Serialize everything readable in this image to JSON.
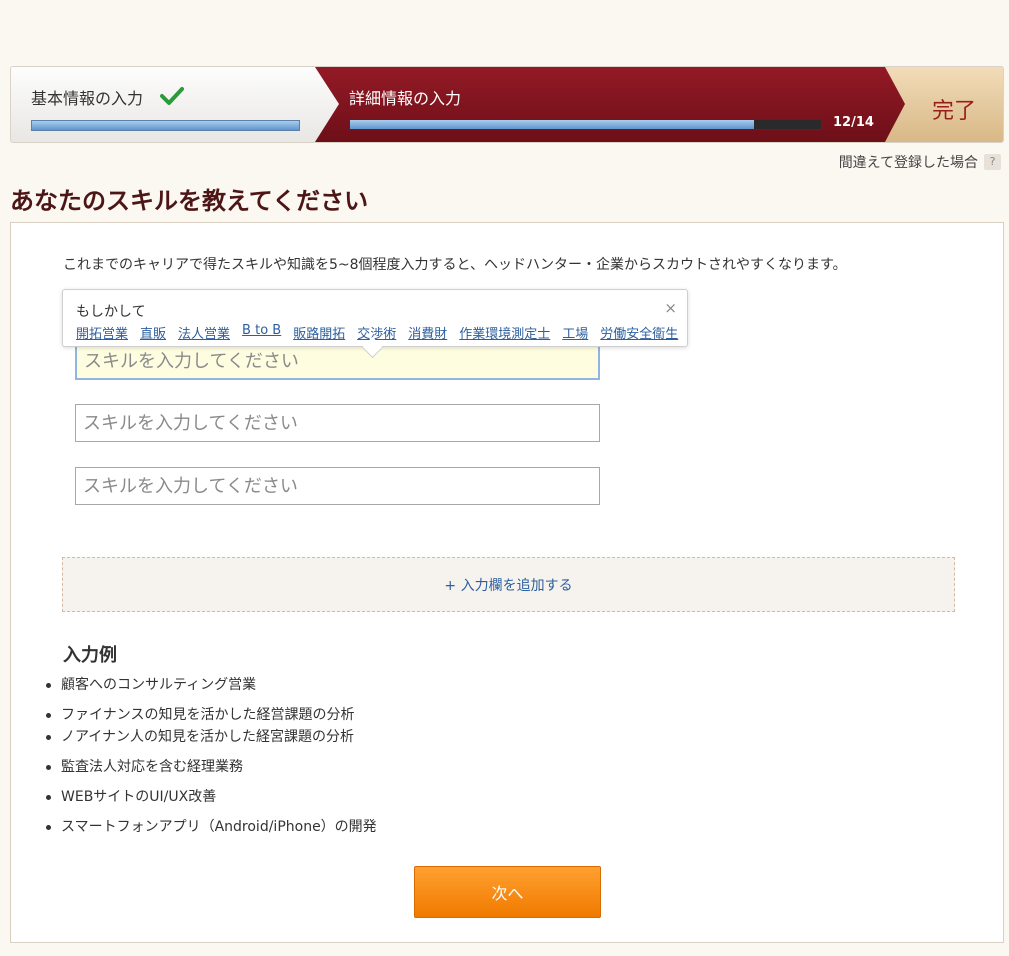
{
  "progress": {
    "step1_label": "基本情報の入力",
    "step1_status": "check-icon",
    "step1_progress": 1.0,
    "step2_label": "詳細情報の入力",
    "step2_count": "12/14",
    "step2_progress": 0.857,
    "step3_label": "完了"
  },
  "mistake_link": "間違えて登録した場合",
  "help_icon": "?",
  "title": "あなたのスキルを教えてください",
  "intro": "これまでのキャリアで得たスキルや知識を5~8個程度入力すると、ヘッドハンター・企業からスカウトされやすくなります。",
  "suggest": {
    "title": "もしかして",
    "close": "×",
    "items": [
      "開拓営業",
      "直販",
      "法人営業",
      "B to B",
      "販路開拓",
      "交渉術",
      "消費財",
      "作業環境測定士",
      "工場",
      "労働安全衛生"
    ]
  },
  "inputs": {
    "placeholder": "スキルを入力してください"
  },
  "add_field_label": "+ 入力欄を追加する",
  "examples_title": "入力例",
  "examples": [
    "顧客へのコンサルティング営業",
    "ファイナンスの知見を活かした経営課題の分析",
    "ノアイナン人の知見を活かした経宮課題の分析",
    "監査法人対応を含む経理業務",
    "WEBサイトのUI/UX改善",
    "スマートフォンアプリ（Android/iPhone）の開発"
  ],
  "next_label": "次へ",
  "colors": {
    "accent": "#7d1420",
    "link": "#2c5f9e",
    "button": "#f28a10"
  }
}
